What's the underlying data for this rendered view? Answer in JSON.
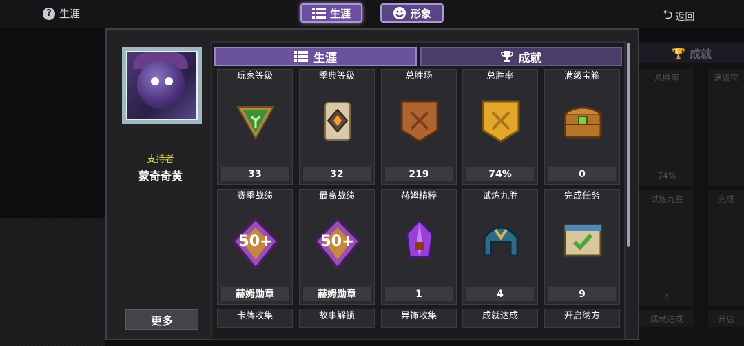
{
  "topbar": {
    "help_label": "生涯",
    "help_icon": "question-icon",
    "tab_career": "生涯",
    "tab_look": "形象",
    "back_label": "返回"
  },
  "profile": {
    "rank": "支持者",
    "name": "蒙奇奇黄",
    "more_button": "更多"
  },
  "tabs": {
    "career": "生涯",
    "achievements": "成就"
  },
  "stats_row1": [
    {
      "title": "玩家等级",
      "value": "33",
      "icon": "green-triangle-icon"
    },
    {
      "title": "季典等级",
      "value": "32",
      "icon": "scroll-emblem-icon"
    },
    {
      "title": "总胜场",
      "value": "219",
      "icon": "bronze-shield-icon"
    },
    {
      "title": "总胜率",
      "value": "74%",
      "icon": "gold-shield-icon"
    },
    {
      "title": "满级宝箱",
      "value": "0",
      "icon": "treasure-chest-icon"
    }
  ],
  "stats_row2": [
    {
      "title": "赛季战绩",
      "value": "赫姆勋章",
      "badge": "50+",
      "icon": "purple-medal-icon"
    },
    {
      "title": "最高战绩",
      "value": "赫姆勋章",
      "badge": "50+",
      "icon": "purple-medal-icon"
    },
    {
      "title": "赫姆精粹",
      "value": "1",
      "icon": "purple-crystal-icon"
    },
    {
      "title": "试炼九胜",
      "value": "4",
      "icon": "helmet-icon"
    },
    {
      "title": "完成任务",
      "value": "9",
      "icon": "checkmark-board-icon"
    }
  ],
  "stats_row3": [
    {
      "title": "卡牌收集"
    },
    {
      "title": "故事解锁"
    },
    {
      "title": "异饰收集"
    },
    {
      "title": "成就达成"
    },
    {
      "title": "开启纳方"
    }
  ],
  "ghost": {
    "tab": "成就",
    "col1_title": "总胜率",
    "col2_title": "满级宝",
    "col1_value": "74%",
    "row2_col1": "试炼九胜",
    "row2_col2": "完成",
    "row2_value": "4",
    "row3_col1": "成就达成",
    "row3_col2": "开启"
  }
}
